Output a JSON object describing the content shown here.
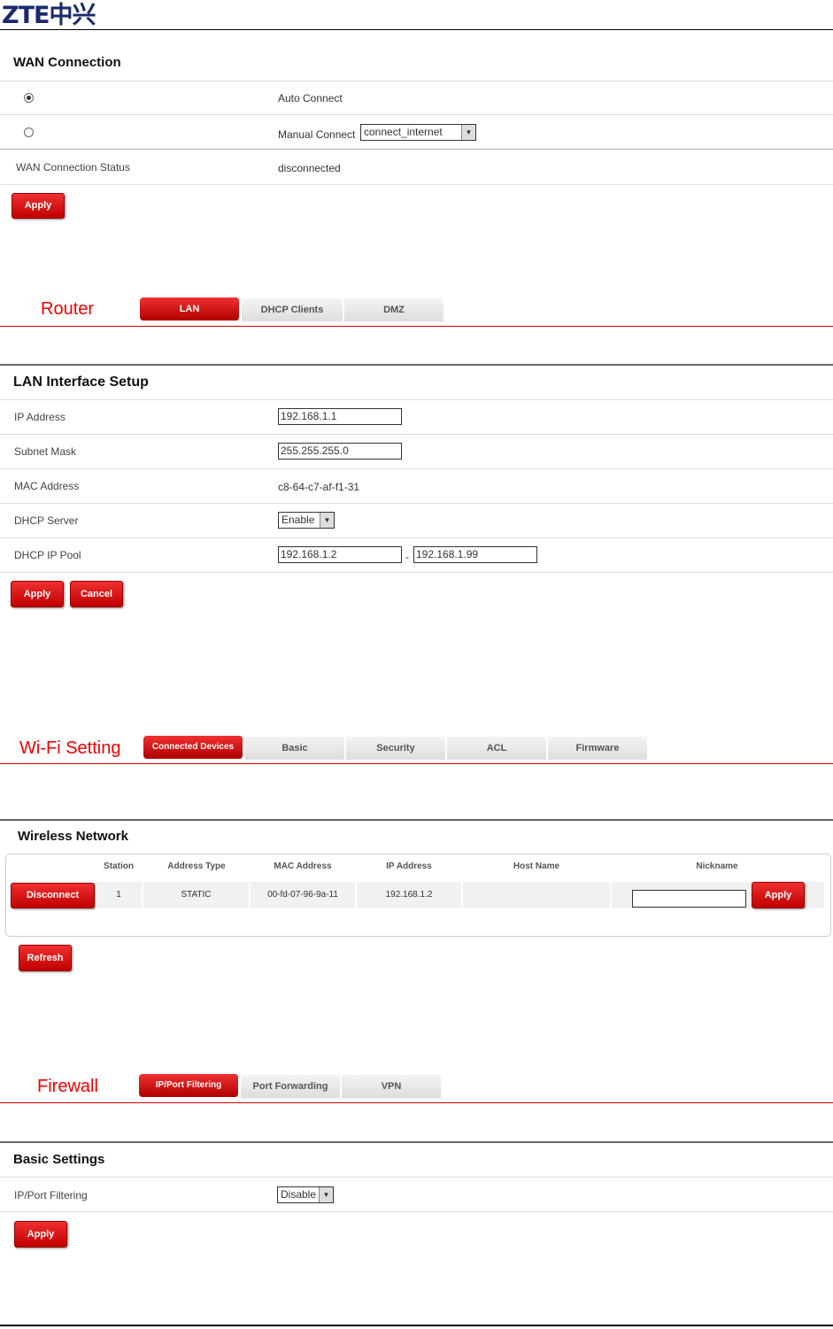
{
  "logo": "ZTE中兴",
  "wan": {
    "title": "WAN Connection",
    "auto_connect": "Auto Connect",
    "manual_connect": "Manual Connect",
    "manual_select": "connect_internet",
    "status_label": "WAN Connection Status",
    "status_value": "disconnected",
    "apply": "Apply"
  },
  "router": {
    "heading": "Router",
    "tabs": [
      "LAN",
      "DHCP Clients",
      "DMZ"
    ],
    "title": "LAN Interface Setup",
    "ip_label": "IP Address",
    "ip_value": "192.168.1.1",
    "mask_label": "Subnet Mask",
    "mask_value": "255.255.255.0",
    "mac_label": "MAC Address",
    "mac_value": "c8-64-c7-af-f1-31",
    "dhcp_label": "DHCP Server",
    "dhcp_value": "Enable",
    "pool_label": "DHCP IP Pool",
    "pool_start": "192.168.1.2",
    "pool_sep": "-",
    "pool_end": "192.168.1.99",
    "apply": "Apply",
    "cancel": "Cancel"
  },
  "wifi": {
    "heading": "Wi-Fi Setting",
    "tabs": [
      "Connected Devices",
      "Basic",
      "Security",
      "ACL",
      "Firmware"
    ],
    "title": "Wireless Network",
    "columns": [
      "Station",
      "Address Type",
      "MAC Address",
      "IP Address",
      "Host Name",
      "Nickname"
    ],
    "row": {
      "disconnect": "Disconnect",
      "station": "1",
      "address_type": "STATIC",
      "mac": "00-fd-07-96-9a-11",
      "ip": "192.168.1.2",
      "host": "",
      "nickname": "",
      "apply": "Apply"
    },
    "refresh": "Refresh"
  },
  "firewall": {
    "heading": "Firewall",
    "tabs": [
      "IP/Port Filtering",
      "Port Forwarding",
      "VPN"
    ],
    "title": "Basic Settings",
    "filter_label": "IP/Port Filtering",
    "filter_value": "Disable",
    "apply": "Apply"
  }
}
